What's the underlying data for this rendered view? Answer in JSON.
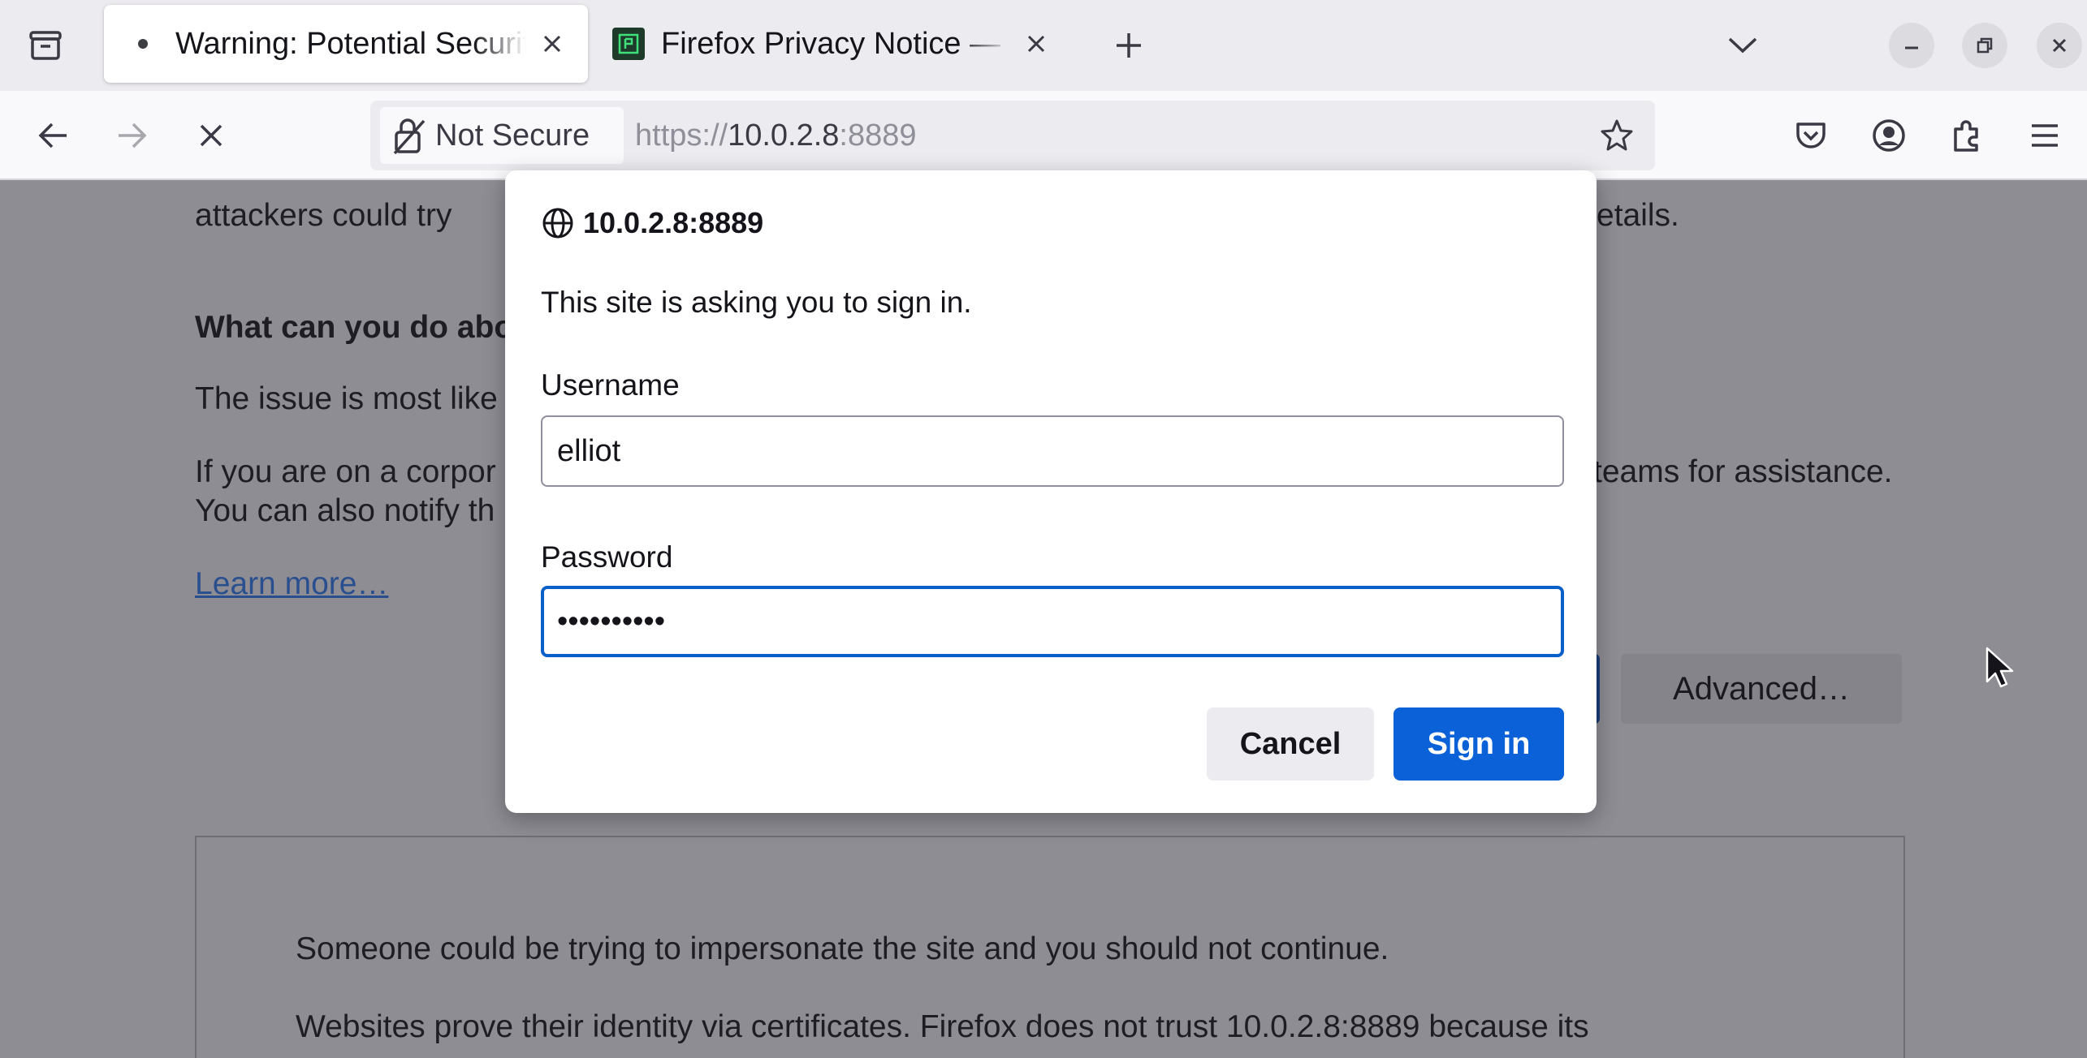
{
  "tabs": [
    {
      "label": "Warning: Potential Security Risk Ahead",
      "active": true
    },
    {
      "label": "Firefox Privacy Notice — Mozilla",
      "active": false
    }
  ],
  "navbar": {
    "security_label": "Not Secure",
    "url_scheme": "https://",
    "url_host": "10.0.2.8",
    "url_port": ":8889"
  },
  "page": {
    "line_attackers_left": "attackers could try",
    "line_attackers_right": "etails.",
    "heading_left": "What can you do abo",
    "issue_left": "The issue is most like",
    "corp_left": "If you are on a corpor",
    "corp_right": "teams for assistance.",
    "notify_left": "You can also notify th",
    "learn_more": "Learn more…",
    "advanced_button": "Advanced…",
    "details_line1": "Someone could be trying to impersonate the site and you should not continue.",
    "details_line2": "Websites prove their identity via certificates. Firefox does not trust 10.0.2.8:8889 because its"
  },
  "dialog": {
    "origin": "10.0.2.8:8889",
    "message": "This site is asking you to sign in.",
    "username_label": "Username",
    "username_value": "elliot",
    "password_label": "Password",
    "password_value": "••••••••••",
    "cancel_label": "Cancel",
    "signin_label": "Sign in"
  },
  "colors": {
    "accent": "#0b61d7",
    "focus_ring": "#0b5fc8",
    "page_dim": "#8e8d94",
    "tabstrip": "#ecebef"
  }
}
